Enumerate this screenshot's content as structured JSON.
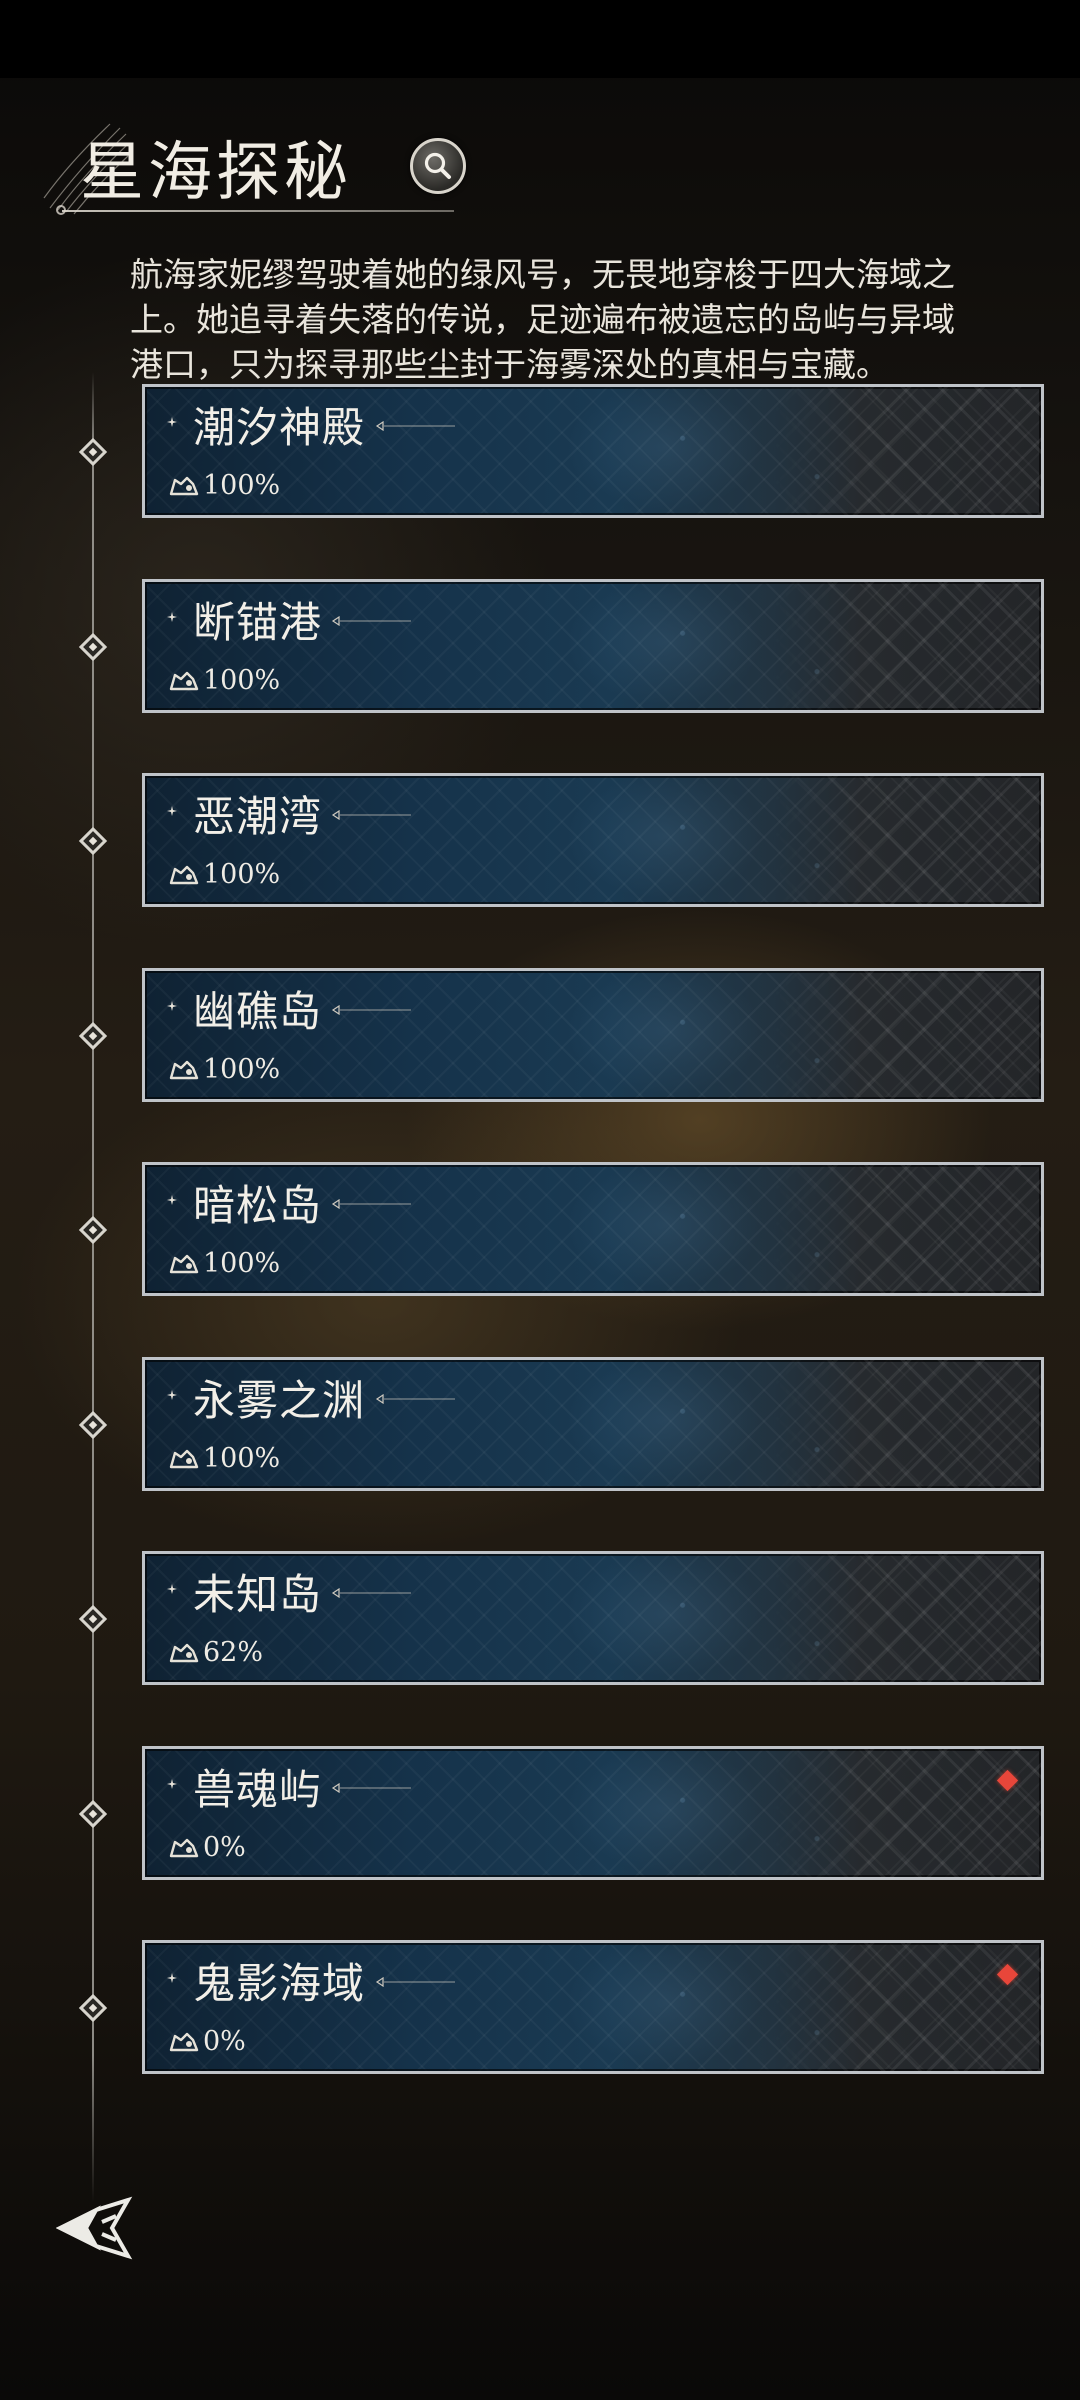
{
  "header": {
    "title": "星海探秘",
    "search_icon": "search-icon"
  },
  "description": "航海家妮缪驾驶着她的绿风号，无畏地穿梭于四大海域之\n上。她追寻着失落的传说，足迹遍布被遗忘的岛屿与异域\n港口，只为探寻那些尘封于海雾深处的真相与宝藏。",
  "locations": [
    {
      "name": "潮汐神殿",
      "progress": "100%",
      "alert": false
    },
    {
      "name": "断锚港",
      "progress": "100%",
      "alert": false
    },
    {
      "name": "恶潮湾",
      "progress": "100%",
      "alert": false
    },
    {
      "name": "幽礁岛",
      "progress": "100%",
      "alert": false
    },
    {
      "name": "暗松岛",
      "progress": "100%",
      "alert": false
    },
    {
      "name": "永雾之渊",
      "progress": "100%",
      "alert": false
    },
    {
      "name": "未知岛",
      "progress": "62%",
      "alert": false
    },
    {
      "name": "兽魂屿",
      "progress": "0%",
      "alert": true
    },
    {
      "name": "鬼影海域",
      "progress": "0%",
      "alert": true
    }
  ],
  "colors": {
    "alert": "#e8463a",
    "card_border": "#bfc3c8",
    "text": "#f2efe8"
  },
  "footer": {
    "back_icon": "back-arrow-icon"
  }
}
